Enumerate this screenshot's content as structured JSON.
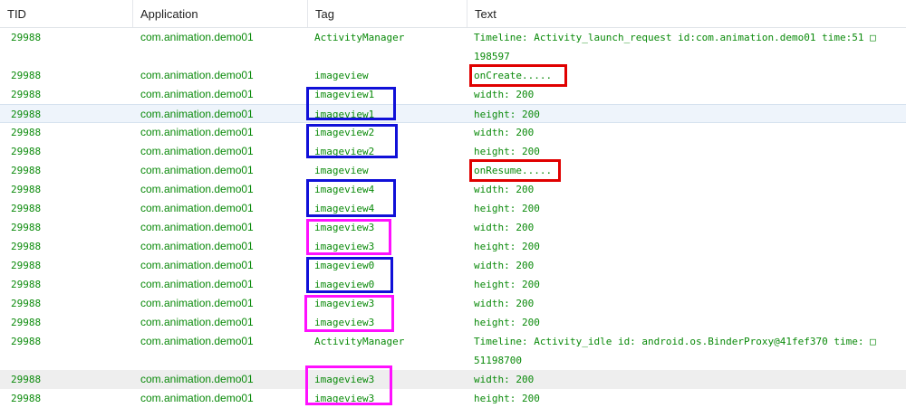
{
  "columns": [
    "TID",
    "Application",
    "Tag",
    "Text"
  ],
  "rows": [
    {
      "tid": "29988",
      "app": "com.animation.demo01",
      "tag": "ActivityManager",
      "text": "Timeline: Activity_launch_request id:com.animation.demo01 time:51 □\n198597"
    },
    {
      "tid": "29988",
      "app": "com.animation.demo01",
      "tag": "imageview",
      "text": "onCreate....."
    },
    {
      "tid": "29988",
      "app": "com.animation.demo01",
      "tag": "imageview1",
      "text": "width: 200"
    },
    {
      "tid": "29988",
      "app": "com.animation.demo01",
      "tag": "imageview1",
      "text": "height: 200"
    },
    {
      "tid": "29988",
      "app": "com.animation.demo01",
      "tag": "imageview2",
      "text": "width: 200"
    },
    {
      "tid": "29988",
      "app": "com.animation.demo01",
      "tag": "imageview2",
      "text": "height: 200"
    },
    {
      "tid": "29988",
      "app": "com.animation.demo01",
      "tag": "imageview",
      "text": "onResume....."
    },
    {
      "tid": "29988",
      "app": "com.animation.demo01",
      "tag": "imageview4",
      "text": "width: 200"
    },
    {
      "tid": "29988",
      "app": "com.animation.demo01",
      "tag": "imageview4",
      "text": "height: 200"
    },
    {
      "tid": "29988",
      "app": "com.animation.demo01",
      "tag": "imageview3",
      "text": "width: 200"
    },
    {
      "tid": "29988",
      "app": "com.animation.demo01",
      "tag": "imageview3",
      "text": "height: 200"
    },
    {
      "tid": "29988",
      "app": "com.animation.demo01",
      "tag": "imageview0",
      "text": "width: 200"
    },
    {
      "tid": "29988",
      "app": "com.animation.demo01",
      "tag": "imageview0",
      "text": "height: 200"
    },
    {
      "tid": "29988",
      "app": "com.animation.demo01",
      "tag": "imageview3",
      "text": "width: 200"
    },
    {
      "tid": "29988",
      "app": "com.animation.demo01",
      "tag": "imageview3",
      "text": "height: 200"
    },
    {
      "tid": "29988",
      "app": "com.animation.demo01",
      "tag": "ActivityManager",
      "text": "Timeline: Activity_idle id: android.os.BinderProxy@41fef370 time: □\n51198700"
    },
    {
      "tid": "29988",
      "app": "com.animation.demo01",
      "tag": "imageview3",
      "text": "width: 200"
    },
    {
      "tid": "29988",
      "app": "com.animation.demo01",
      "tag": "imageview3",
      "text": "height: 200"
    }
  ],
  "colors": {
    "log_text": "#0a8a0a",
    "highlight_red": "#e00000",
    "highlight_blue": "#1010d8",
    "highlight_magenta": "#ff10ff",
    "selected_row": "#eef4fb",
    "hover_row": "#eeeeee"
  }
}
